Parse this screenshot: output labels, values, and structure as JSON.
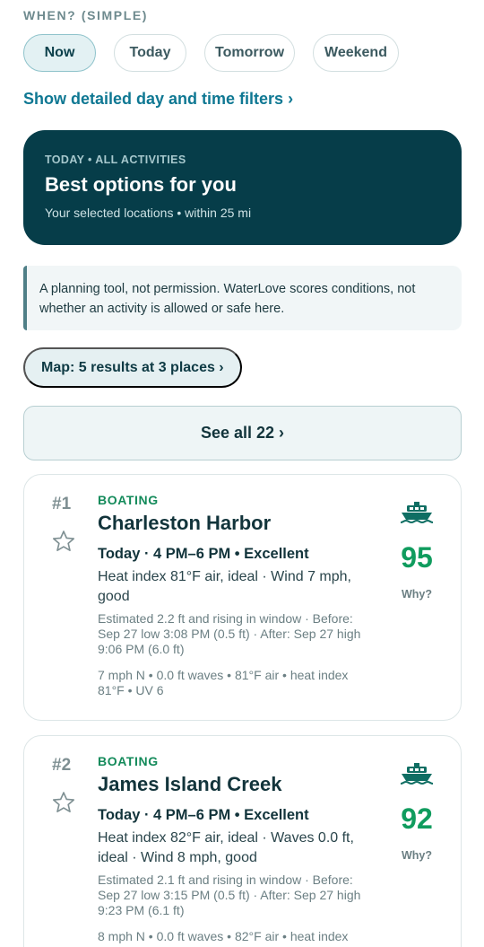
{
  "when": {
    "label": "WHEN? (SIMPLE)",
    "chips": [
      {
        "label": "Now",
        "active": true
      },
      {
        "label": "Today",
        "active": false
      },
      {
        "label": "Tomorrow",
        "active": false
      },
      {
        "label": "Weekend",
        "active": false
      }
    ],
    "detail_link": "Show detailed day and time filters ›"
  },
  "hero": {
    "eyebrow": "TODAY • ALL ACTIVITIES",
    "title": "Best options for you",
    "subtitle": "Your selected locations • within 25 mi"
  },
  "notice": "A planning tool, not permission. WaterLove scores conditions, not whether an activity is allowed or safe here.",
  "map_pill": "Map: 5 results at 3 places ›",
  "see_all": "See all 22 ›",
  "results": [
    {
      "rank": "#1",
      "category": "BOATING",
      "place": "Charleston Harbor",
      "window": "Today · 4 PM–6 PM • Excellent",
      "detail": "Heat index 81°F air, ideal · Wind 7 mph, good",
      "tides": "Estimated 2.2 ft and rising in window · Before: Sep 27 low 3:08 PM (0.5 ft) · After: Sep 27 high 9:06 PM (6.0 ft)",
      "conditions": "7 mph N • 0.0 ft waves • 81°F air • heat index 81°F • UV 6",
      "score": "95",
      "why": "Why?",
      "activity_icon": "boat-icon"
    },
    {
      "rank": "#2",
      "category": "BOATING",
      "place": "James Island Creek",
      "window": "Today · 4 PM–6 PM • Excellent",
      "detail": "Heat index 82°F air, ideal · Waves 0.0 ft, ideal · Wind 8 mph, good",
      "tides": "Estimated 2.1 ft and rising in window · Before: Sep 27 low 3:15 PM (0.5 ft) · After: Sep 27 high 9:23 PM (6.1 ft)",
      "conditions": "8 mph N • 0.0 ft waves • 82°F air • heat index",
      "score": "92",
      "why": "Why?",
      "activity_icon": "boat-icon"
    }
  ],
  "colors": {
    "accent": "#0f7893",
    "hero_bg": "#063d49",
    "score_green": "#109c5e",
    "category_green": "#138a5a"
  }
}
